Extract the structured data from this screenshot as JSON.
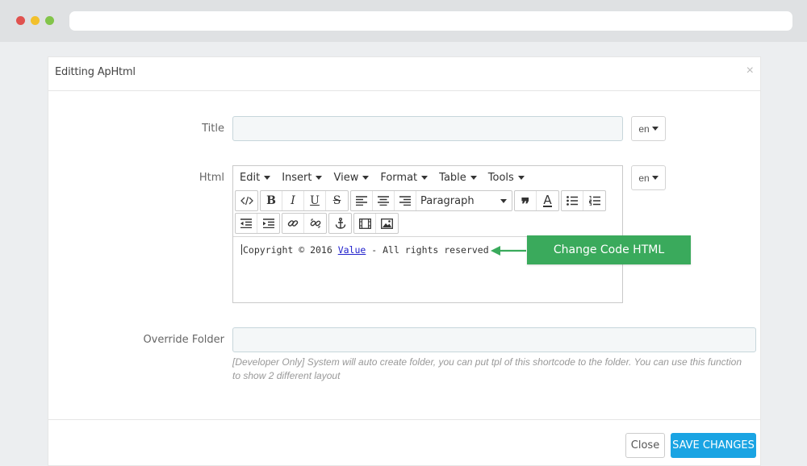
{
  "modal": {
    "title": "Editting ApHtml",
    "close_symbol": "×"
  },
  "form": {
    "title_label": "Title",
    "title_value": "",
    "html_label": "Html",
    "lang": "en",
    "override_label": "Override Folder",
    "override_value": "",
    "override_help": "[Developer Only] System will auto create folder, you can put tpl of this shortcode to the folder. You can use this function to show 2 different layout"
  },
  "editor": {
    "menus": [
      "Edit",
      "Insert",
      "View",
      "Format",
      "Table",
      "Tools"
    ],
    "block_format": "Paragraph",
    "content_before": "Copyright © 2016 ",
    "content_link": "Value",
    "content_after": " - All rights reserved"
  },
  "callout": {
    "text": "Change Code HTML",
    "color": "#3aaa5c"
  },
  "footer": {
    "close_label": "Close",
    "save_label": "SAVE CHANGES",
    "save_color": "#1aa4e3"
  },
  "icons": {
    "toolbar": [
      "code-icon",
      "bold-icon",
      "italic-icon",
      "underline-icon",
      "strikethrough-icon",
      "align-left-icon",
      "align-center-icon",
      "align-right-icon",
      "blockquote-icon",
      "text-color-icon",
      "bullet-list-icon",
      "numbered-list-icon",
      "outdent-icon",
      "indent-icon",
      "link-icon",
      "unlink-icon",
      "anchor-icon",
      "media-icon",
      "image-icon"
    ]
  }
}
